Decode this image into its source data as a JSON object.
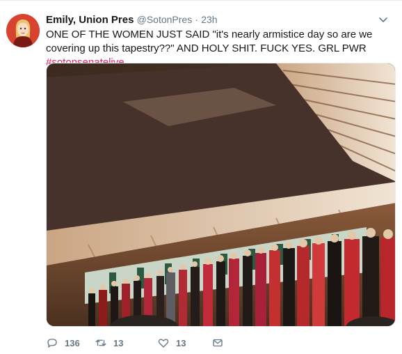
{
  "tweet": {
    "author_name": "Emily, Union Pres",
    "handle": "@SotonPres",
    "separator": "·",
    "time": "23h",
    "text_main": "ONE OF THE WOMEN JUST SAID \"it's nearly armistice day so are we covering up this tapestry??\" AND HOLY SHIT. FUCK YES. GRL PWR ",
    "hashtag": "#sotonsenatelive"
  },
  "actions": {
    "reply_count": "136",
    "retweet_count": "13",
    "like_count": "13"
  },
  "colors": {
    "hashtag": "#e0245e",
    "meta": "#657786",
    "text": "#14171a",
    "avatar_bg": "#d8432f"
  },
  "icons": [
    "chevron-down-icon",
    "reply-icon",
    "retweet-icon",
    "like-icon",
    "direct-message-icon"
  ]
}
